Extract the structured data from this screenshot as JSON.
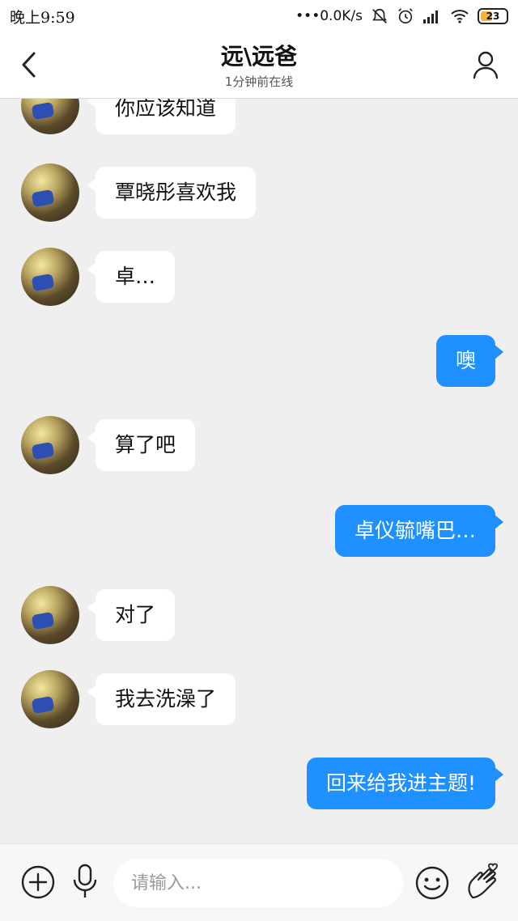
{
  "status_bar": {
    "time": "晚上9:59",
    "network_speed": "•••0.0K/s",
    "battery_level": "23",
    "icons": [
      "mute-bell-icon",
      "alarm-icon",
      "signal-icon",
      "wifi-icon",
      "battery-icon"
    ]
  },
  "header": {
    "title": "远\\远爸",
    "subtitle": "1分钟前在线",
    "back_icon": "chevron-left-icon",
    "profile_icon": "person-icon"
  },
  "messages": [
    {
      "side": "left",
      "text": "你应该知道"
    },
    {
      "side": "left",
      "text": "覃晓彤喜欢我"
    },
    {
      "side": "left",
      "text": "卓…"
    },
    {
      "side": "right",
      "text": "噢"
    },
    {
      "side": "left",
      "text": "算了吧"
    },
    {
      "side": "right",
      "text": "卓仪毓嘴巴…"
    },
    {
      "side": "left",
      "text": "对了"
    },
    {
      "side": "left",
      "text": "我去洗澡了"
    },
    {
      "side": "right",
      "text": "回来给我进主题!"
    }
  ],
  "input_bar": {
    "placeholder": "请输入...",
    "icons": [
      "plus-circle-icon",
      "microphone-icon",
      "emoji-icon",
      "hand-heart-icon"
    ]
  },
  "colors": {
    "accent": "#1e90ff",
    "background": "#efefef",
    "bubble_left": "#ffffff"
  }
}
